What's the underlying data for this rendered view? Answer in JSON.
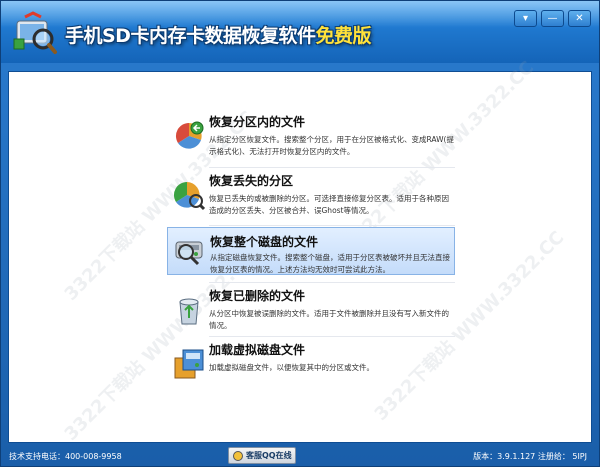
{
  "window": {
    "title_main": "手机SD卡内存卡数据恢复软件",
    "title_free": "免费版",
    "controls": {
      "minimize": "▾",
      "min": "—",
      "close": "✕"
    }
  },
  "items": [
    {
      "title": "恢复分区内的文件",
      "desc": "从指定分区恢复文件。搜索整个分区，用于在分区被格式化、变成RAW(提示格式化)、无法打开时恢复分区内的文件。",
      "icon": "partition-files-icon"
    },
    {
      "title": "恢复丢失的分区",
      "desc": "恢复已丢失的或被删除的分区。可选择直接修复分区表。适用于各种原因造成的分区丢失、分区被合并、误Ghost等情况。",
      "icon": "lost-partition-icon"
    },
    {
      "title": "恢复整个磁盘的文件",
      "desc": "从指定磁盘恢复文件。搜索整个磁盘，适用于分区表被破坏并且无法直接恢复分区表的情况。上述方法均无效时可尝试此方法。",
      "icon": "whole-disk-icon"
    },
    {
      "title": "恢复已删除的文件",
      "desc": "从分区中恢复被误删除的文件。适用于文件被删除并且没有写入新文件的情况。",
      "icon": "recycle-bin-icon"
    },
    {
      "title": "加载虚拟磁盘文件",
      "desc": "加载虚拟磁盘文件，以便恢复其中的分区或文件。",
      "icon": "virtual-disk-icon"
    }
  ],
  "watermark": "3322下载站 WWW.3322.CC",
  "statusbar": {
    "support": "技术支持电话：400-008-9958",
    "qq_button": "客服QQ在线",
    "version": "版本：3.9.1.127  注册给：  5IPJ"
  }
}
